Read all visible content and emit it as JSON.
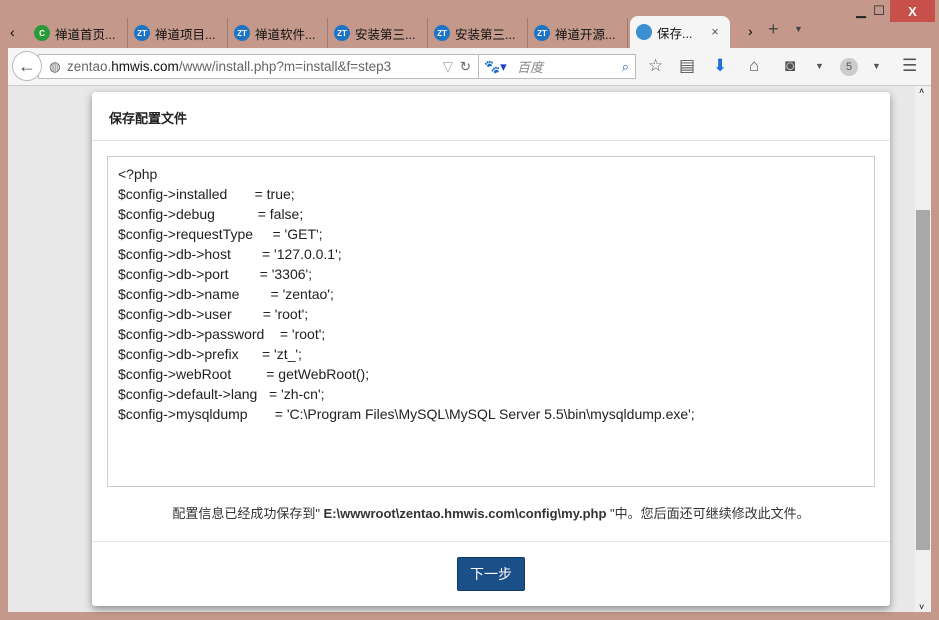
{
  "window": {
    "minimize": "▁",
    "maximize": "☐",
    "close": "X"
  },
  "tabs": [
    {
      "label": "禅道首页...",
      "icon": "C"
    },
    {
      "label": "禅道项目...",
      "icon": "ZT"
    },
    {
      "label": "禅道软件...",
      "icon": "ZT"
    },
    {
      "label": "安装第三...",
      "icon": "ZT"
    },
    {
      "label": "安装第三...",
      "icon": "ZT"
    },
    {
      "label": "禅道开源...",
      "icon": "ZT"
    },
    {
      "label": "保存...",
      "icon": "globe"
    }
  ],
  "toolbar": {
    "url_pre": "zentao.",
    "url_host": "hmwis.com",
    "url_path": "/www/install.php?m=install&f=step3",
    "search_placeholder": "百度",
    "badge": "5"
  },
  "modal": {
    "title": "保存配置文件",
    "config": "<?php\n$config->installed       = true;\n$config->debug           = false;\n$config->requestType     = 'GET';\n$config->db->host        = '127.0.0.1';\n$config->db->port        = '3306';\n$config->db->name        = 'zentao';\n$config->db->user        = 'root';\n$config->db->password    = 'root';\n$config->db->prefix      = 'zt_';\n$config->webRoot         = getWebRoot();\n$config->default->lang   = 'zh-cn';\n$config->mysqldump       = 'C:\\Program Files\\MySQL\\MySQL Server 5.5\\bin\\mysqldump.exe';",
    "msg_pre": "配置信息已经成功保存到\" ",
    "msg_path": "E:\\wwwroot\\zentao.hmwis.com\\config\\my.php",
    "msg_post": " \"中。您后面还可继续修改此文件。",
    "next": "下一步"
  }
}
